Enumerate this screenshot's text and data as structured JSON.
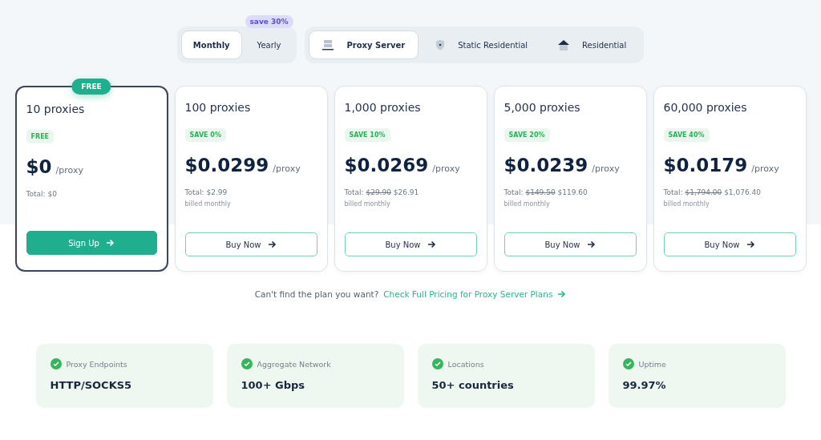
{
  "billing_tabs": [
    {
      "label": "Monthly",
      "selected": true
    },
    {
      "label": "Yearly",
      "selected": false,
      "badge": "save 30%"
    }
  ],
  "product_tabs": [
    {
      "label": "Proxy Server",
      "selected": true
    },
    {
      "label": "Static Residential",
      "selected": false
    },
    {
      "label": "Residential",
      "selected": false
    }
  ],
  "plans": [
    {
      "name": "10 proxies",
      "featured": true,
      "ribbon": "FREE",
      "tag": "FREE",
      "price": "$0",
      "unit": "/proxy",
      "total_label": "Total:",
      "total": "$0",
      "button": "Sign Up"
    },
    {
      "name": "100 proxies",
      "featured": false,
      "tag": "SAVE 0%",
      "price": "$0.0299",
      "unit": "/proxy",
      "total_label": "Total:",
      "total": "$2.99",
      "billing": "billed monthly",
      "button": "Buy Now"
    },
    {
      "name": "1,000 proxies",
      "featured": false,
      "tag": "SAVE 10%",
      "price": "$0.0269",
      "unit": "/proxy",
      "total_label": "Total:",
      "total_old": "$29.90",
      "total": "$26.91",
      "billing": "billed monthly",
      "button": "Buy Now"
    },
    {
      "name": "5,000 proxies",
      "featured": false,
      "tag": "SAVE 20%",
      "price": "$0.0239",
      "unit": "/proxy",
      "total_label": "Total:",
      "total_old": "$149.50",
      "total": "$119.60",
      "billing": "billed monthly",
      "button": "Buy Now"
    },
    {
      "name": "60,000 proxies",
      "featured": false,
      "tag": "SAVE 40%",
      "price": "$0.0179",
      "unit": "/proxy",
      "total_label": "Total:",
      "total_old": "$1,794.00",
      "total": "$1,076.40",
      "billing": "billed monthly",
      "button": "Buy Now"
    }
  ],
  "footer_note": {
    "text": "Can't find the plan you want?",
    "link": "Check Full Pricing for Proxy Server Plans"
  },
  "stats": [
    {
      "label": "Proxy Endpoints",
      "value": "HTTP/SOCKS5"
    },
    {
      "label": "Aggregate Network",
      "value": "100+ Gbps"
    },
    {
      "label": "Locations",
      "value": "50+ countries"
    },
    {
      "label": "Uptime",
      "value": "99.97%"
    }
  ]
}
